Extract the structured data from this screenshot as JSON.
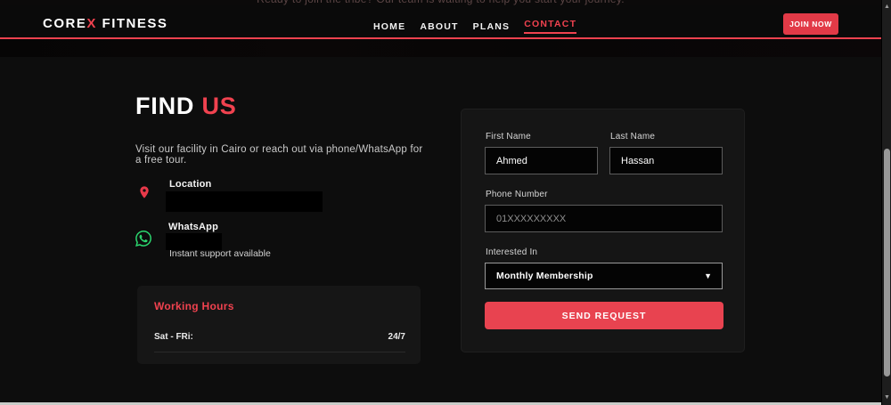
{
  "top_strip": {
    "text": "Ready to join the tribe? Our team is waiting to help you start your journey."
  },
  "header": {
    "logo": {
      "part1": "CORE",
      "accent": "X",
      "part2": " FITNESS"
    },
    "nav": [
      {
        "label": "HOME",
        "active": false
      },
      {
        "label": "ABOUT",
        "active": false
      },
      {
        "label": "PLANS",
        "active": false
      },
      {
        "label": "CONTACT",
        "active": true
      }
    ],
    "join_button": "JOIN NOW"
  },
  "find_us": {
    "title_main": "FIND",
    "title_accent": " US",
    "subtitle": "Visit our facility in Cairo or reach out via phone/WhatsApp for a free tour.",
    "location": {
      "label": "Location",
      "icon": "map-pin-icon",
      "value_redacted": true
    },
    "whatsapp": {
      "label": "WhatsApp",
      "icon": "whatsapp-icon",
      "value_redacted": true,
      "note": "Instant support available"
    },
    "working_hours": {
      "title": "Working Hours",
      "rows": [
        {
          "days": "Sat - FRi:",
          "hours": "24/7"
        }
      ]
    }
  },
  "form": {
    "first_name": {
      "label": "First Name",
      "value": "Ahmed"
    },
    "last_name": {
      "label": "Last Name",
      "value": "Hassan"
    },
    "phone": {
      "label": "Phone Number",
      "placeholder": "01XXXXXXXXX"
    },
    "interested": {
      "label": "Interested In",
      "selected": "Monthly Membership"
    },
    "submit_label": "SEND REQUEST"
  },
  "colors": {
    "accent": "#e8394a",
    "whatsapp_green": "#2bd66e",
    "page_background": "#0d0d0d"
  }
}
